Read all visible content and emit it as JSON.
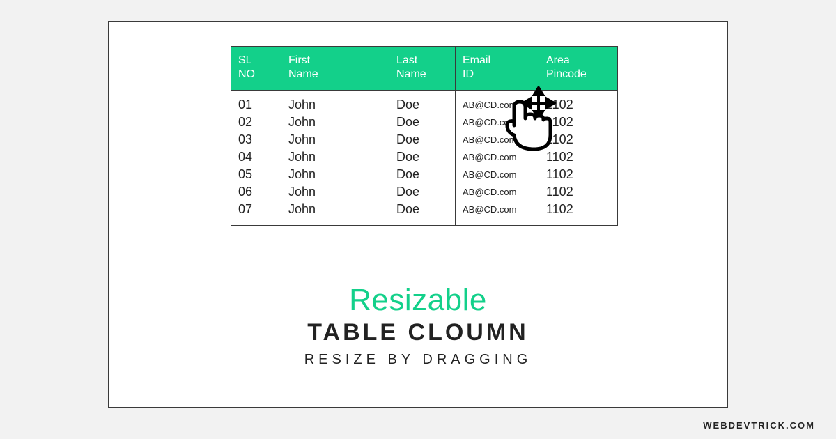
{
  "site_label": "WEBDEVTRICK.COM",
  "title": {
    "line1": "Resizable",
    "line2": "TABLE CLOUMN",
    "line3": "RESIZE BY DRAGGING"
  },
  "table": {
    "headers": {
      "sl": "SL\nNO",
      "first": "First\nName",
      "last": "Last\nName",
      "email": "Email\nID",
      "area": "Area\nPincode"
    },
    "rows": [
      {
        "sl": "01",
        "first": "John",
        "last": "Doe",
        "email": "AB@CD.com",
        "area": "1102"
      },
      {
        "sl": "02",
        "first": "John",
        "last": "Doe",
        "email": "AB@CD.com",
        "area": "1102"
      },
      {
        "sl": "03",
        "first": "John",
        "last": "Doe",
        "email": "AB@CD.com",
        "area": "1102"
      },
      {
        "sl": "04",
        "first": "John",
        "last": "Doe",
        "email": "AB@CD.com",
        "area": "1102"
      },
      {
        "sl": "05",
        "first": "John",
        "last": "Doe",
        "email": "AB@CD.com",
        "area": "1102"
      },
      {
        "sl": "06",
        "first": "John",
        "last": "Doe",
        "email": "AB@CD.com",
        "area": "1102"
      },
      {
        "sl": "07",
        "first": "John",
        "last": "Doe",
        "email": "AB@CD.com",
        "area": "1102"
      }
    ]
  }
}
